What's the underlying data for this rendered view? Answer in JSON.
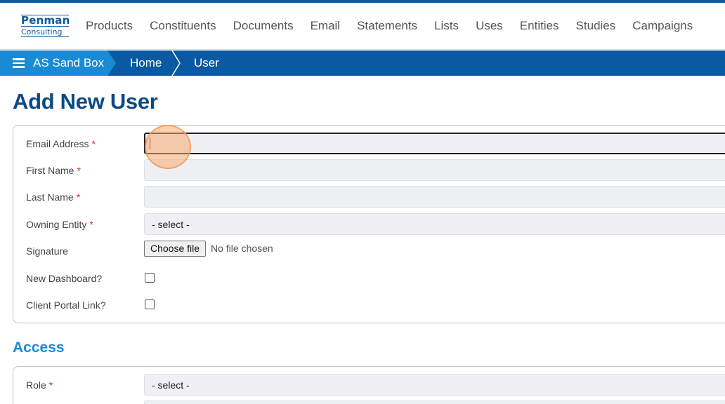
{
  "brand": {
    "logo_line1": "Penman",
    "logo_line2": "Consulting"
  },
  "nav": {
    "items": [
      {
        "label": "Products"
      },
      {
        "label": "Constituents"
      },
      {
        "label": "Documents"
      },
      {
        "label": "Email"
      },
      {
        "label": "Statements"
      },
      {
        "label": "Lists"
      },
      {
        "label": "Uses"
      },
      {
        "label": "Entities"
      },
      {
        "label": "Studies"
      },
      {
        "label": "Campaigns"
      }
    ]
  },
  "breadcrumb": {
    "root": "AS Sand Box",
    "items": [
      {
        "label": "Home"
      },
      {
        "label": "User"
      }
    ]
  },
  "page": {
    "title": "Add New User"
  },
  "user_form": {
    "email": {
      "label": "Email Address",
      "required": "*",
      "value": ""
    },
    "first_name": {
      "label": "First Name",
      "required": "*",
      "value": ""
    },
    "last_name": {
      "label": "Last Name",
      "required": "*",
      "value": ""
    },
    "owning_entity": {
      "label": "Owning Entity",
      "required": "*",
      "selected": "- select -"
    },
    "signature": {
      "label": "Signature",
      "button": "Choose file",
      "status": "No file chosen"
    },
    "new_dashboard": {
      "label": "New Dashboard?",
      "checked": false
    },
    "client_portal": {
      "label": "Client Portal Link?",
      "checked": false
    }
  },
  "access": {
    "title": "Access",
    "role": {
      "label": "Role",
      "required": "*",
      "selected": "- select -"
    }
  },
  "colors": {
    "primary": "#0a5aa3",
    "accent": "#1a8ad4",
    "required": "#d0312d",
    "click_marker": "#f7aa6e"
  },
  "icons": {
    "menu": "hamburger-icon",
    "separator": "chevron-right-icon"
  }
}
